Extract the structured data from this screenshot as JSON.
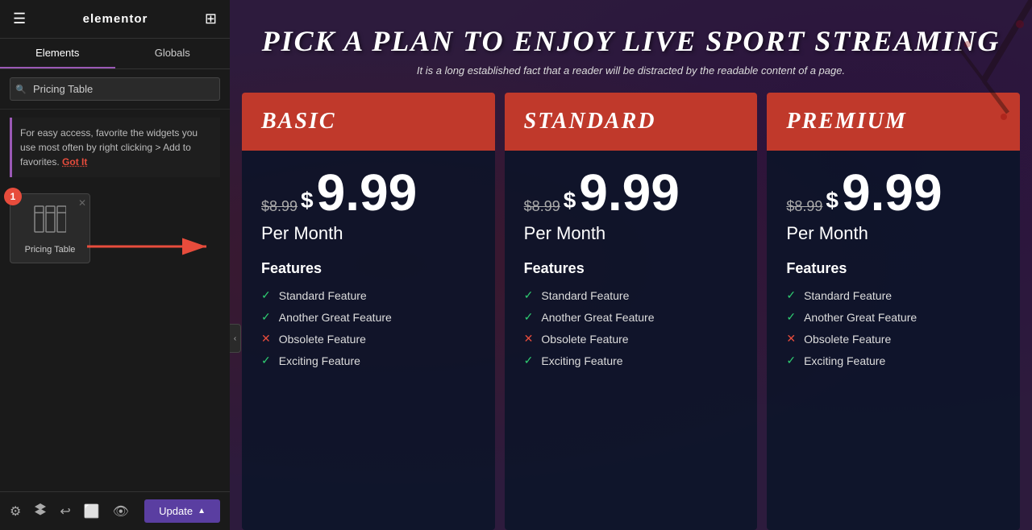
{
  "header": {
    "logo": "elementor",
    "hamburger_label": "☰",
    "grid_label": "⊞"
  },
  "tabs": {
    "elements_label": "Elements",
    "globals_label": "Globals",
    "active": "elements"
  },
  "search": {
    "placeholder": "Pricing Table",
    "value": "Pricing Table"
  },
  "info": {
    "message": "For easy access, favorite the widgets you use most often by right clicking > Add to favorites.",
    "got_it": "Got It"
  },
  "widget": {
    "label": "Pricing Table",
    "badge": "1"
  },
  "toolbar": {
    "update_label": "Update",
    "settings_icon": "⚙",
    "layers_icon": "⬡",
    "history_icon": "↩",
    "responsive_icon": "⬜",
    "display_icon": "👁"
  },
  "page": {
    "title": "Pick a plan to enjoy live sport streaming",
    "subtitle": "It is a long established fact that a reader will be distracted by the readable content of a page."
  },
  "pricing_cards": [
    {
      "id": "basic",
      "title": "Basic",
      "original_price": "$8.99",
      "currency": "$",
      "price": "9.99",
      "period": "Per Month",
      "features_label": "Features",
      "features": [
        {
          "text": "Standard Feature",
          "included": true
        },
        {
          "text": "Another Great Feature",
          "included": true
        },
        {
          "text": "Obsolete Feature",
          "included": false
        },
        {
          "text": "Exciting Feature",
          "included": true
        }
      ]
    },
    {
      "id": "standard",
      "title": "Standard",
      "original_price": "$8.99",
      "currency": "$",
      "price": "9.99",
      "period": "Per Month",
      "features_label": "Features",
      "features": [
        {
          "text": "Standard Feature",
          "included": true
        },
        {
          "text": "Another Great Feature",
          "included": true
        },
        {
          "text": "Obsolete Feature",
          "included": false
        },
        {
          "text": "Exciting Feature",
          "included": true
        }
      ]
    },
    {
      "id": "premium",
      "title": "Premium",
      "original_price": "$8.99",
      "currency": "$",
      "price": "9.99",
      "period": "Per Month",
      "features_label": "Features",
      "features": [
        {
          "text": "Standard Feature",
          "included": true
        },
        {
          "text": "Another Great Feature",
          "included": true
        },
        {
          "text": "Obsolete Feature",
          "included": false
        },
        {
          "text": "Exciting Feature",
          "included": true
        }
      ]
    }
  ]
}
